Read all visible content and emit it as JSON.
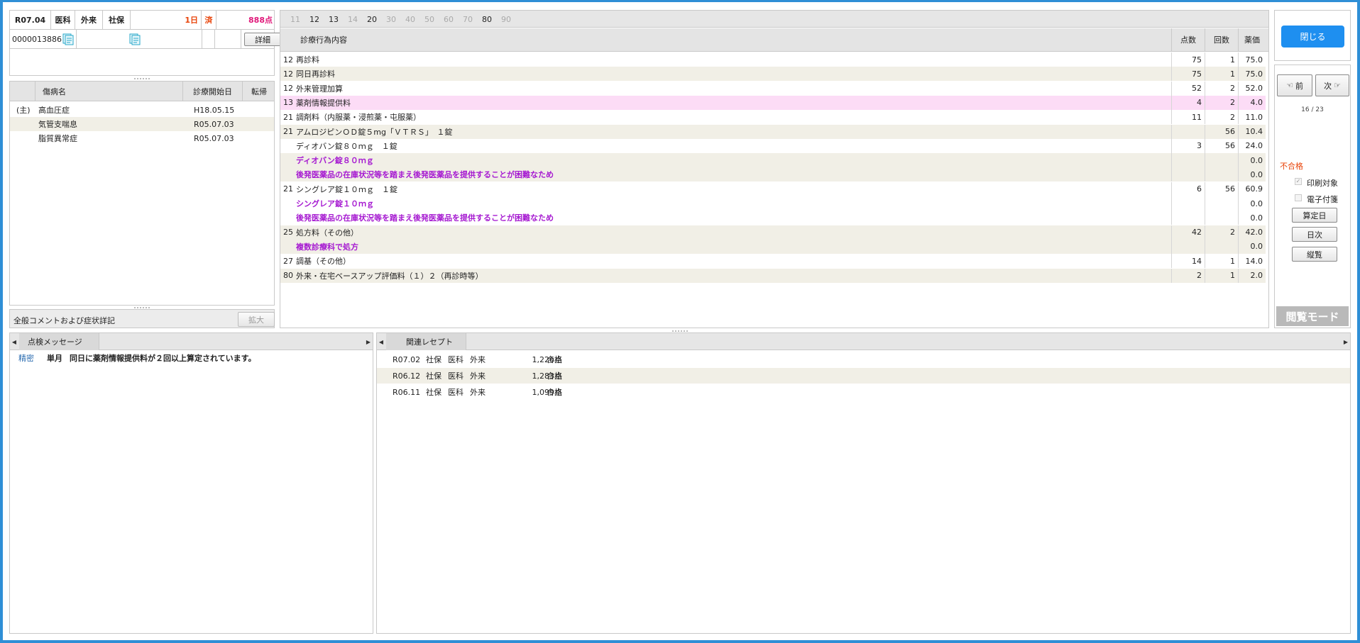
{
  "patient": {
    "month": "R07.04",
    "category": "医科",
    "type": "外来",
    "insurance": "社保",
    "days": "1日",
    "status": "済",
    "points": "888点",
    "id": "0000013886",
    "detail_button": "詳細"
  },
  "disease_table": {
    "headers": [
      "傷病名",
      "診療開始日",
      "転帰"
    ],
    "rows": [
      {
        "mark": "(主)",
        "name": "高血圧症",
        "date": "H18.05.15",
        "outcome": ""
      },
      {
        "mark": "",
        "name": "気管支喘息",
        "date": "R05.07.03",
        "outcome": ""
      },
      {
        "mark": "",
        "name": "脂質異常症",
        "date": "R05.07.03",
        "outcome": ""
      }
    ]
  },
  "comment": {
    "label": "全般コメントおよび症状詳記",
    "expand_button": "拡大"
  },
  "filter_tabs": [
    {
      "label": "11",
      "active": false
    },
    {
      "label": "12",
      "active": true
    },
    {
      "label": "13",
      "active": true
    },
    {
      "label": "14",
      "active": false
    },
    {
      "label": "20",
      "active": true
    },
    {
      "label": "30",
      "active": false
    },
    {
      "label": "40",
      "active": false
    },
    {
      "label": "50",
      "active": false
    },
    {
      "label": "60",
      "active": false
    },
    {
      "label": "70",
      "active": false
    },
    {
      "label": "80",
      "active": true
    },
    {
      "label": "90",
      "active": false
    }
  ],
  "treatment_table": {
    "headers": [
      "診療行為内容",
      "点数",
      "回数",
      "薬価"
    ],
    "rows": [
      {
        "code": "12",
        "name": "再診料",
        "points": "75",
        "count": "1",
        "price": "75.0",
        "style": "normal"
      },
      {
        "code": "12",
        "name": "同日再診料",
        "points": "75",
        "count": "1",
        "price": "75.0",
        "style": "alt"
      },
      {
        "code": "12",
        "name": "外来管理加算",
        "points": "52",
        "count": "2",
        "price": "52.0",
        "style": "normal"
      },
      {
        "code": "13",
        "name": "薬剤情報提供料",
        "points": "4",
        "count": "2",
        "price": "4.0",
        "style": "pink"
      },
      {
        "code": "21",
        "name": "調剤料（内服薬・浸煎薬・屯服薬）",
        "points": "11",
        "count": "2",
        "price": "11.0",
        "style": "normal"
      },
      {
        "code": "21",
        "name": "アムロジピンＯＤ錠５mg「ＶＴＲＳ」　１錠",
        "points": "",
        "count": "56",
        "price": "10.4",
        "style": "alt"
      },
      {
        "code": "",
        "name": "ディオバン錠８０ｍｇ　１錠",
        "points": "3",
        "count": "56",
        "price": "24.0",
        "style": "normal"
      },
      {
        "code": "",
        "name": "ディオバン錠８０ｍｇ",
        "points": "",
        "count": "",
        "price": "0.0",
        "style": "alt-purple"
      },
      {
        "code": "",
        "name": "後発医薬品の在庫状況等を踏まえ後発医薬品を提供することが困難なため",
        "points": "",
        "count": "",
        "price": "0.0",
        "style": "alt-purple"
      },
      {
        "code": "21",
        "name": "シングレア錠１０ｍｇ　１錠",
        "points": "6",
        "count": "56",
        "price": "60.9",
        "style": "normal"
      },
      {
        "code": "",
        "name": "シングレア錠１０ｍｇ",
        "points": "",
        "count": "",
        "price": "0.0",
        "style": "purple"
      },
      {
        "code": "",
        "name": "後発医薬品の在庫状況等を踏まえ後発医薬品を提供することが困難なため",
        "points": "",
        "count": "",
        "price": "0.0",
        "style": "purple"
      },
      {
        "code": "25",
        "name": "処方料（その他）",
        "points": "42",
        "count": "2",
        "price": "42.0",
        "style": "alt"
      },
      {
        "code": "",
        "name": "複数診療科で処方",
        "points": "",
        "count": "",
        "price": "0.0",
        "style": "alt-purple"
      },
      {
        "code": "27",
        "name": "調基（その他）",
        "points": "14",
        "count": "1",
        "price": "14.0",
        "style": "normal"
      },
      {
        "code": "80",
        "name": "外来・在宅ベースアップ評価料（１）２（再診時等）",
        "points": "2",
        "count": "1",
        "price": "2.0",
        "style": "alt"
      }
    ]
  },
  "side": {
    "close_button": "閉じる",
    "prev_button": "前",
    "next_button": "次",
    "page_counter": "16 / 23",
    "status": "不合格",
    "print_target": "印刷対象",
    "electronic_attach": "電子付箋",
    "calc_date_button": "算定日",
    "daily_button": "日次",
    "vertical_button": "縦覧",
    "mode_label": "閲覧モード"
  },
  "messages": {
    "tab": "点検メッセージ",
    "rows": [
      {
        "type": "精密",
        "scope": "単月",
        "text": "同日に薬剤情報提供料が２回以上算定されています。"
      }
    ]
  },
  "related": {
    "tab": "関連レセプト",
    "rows": [
      {
        "month": "R07.02",
        "insurance": "社保",
        "category": "医科",
        "type": "外来",
        "points": "1,226点",
        "result": "合格"
      },
      {
        "month": "R06.12",
        "insurance": "社保",
        "category": "医科",
        "type": "外来",
        "points": "1,283点",
        "result": "合格"
      },
      {
        "month": "R06.11",
        "insurance": "社保",
        "category": "医科",
        "type": "外来",
        "points": "1,099点",
        "result": "合格"
      }
    ]
  },
  "colors": {
    "frame": "#2f8fd6",
    "close_button": "#1e8ff0",
    "days": "#e8440a",
    "points": "#e0197a",
    "status_fail": "#e8440a",
    "pink_row": "#fcdcf6",
    "alt_row": "#f1efe6",
    "purple_text": "#a61ad1"
  }
}
